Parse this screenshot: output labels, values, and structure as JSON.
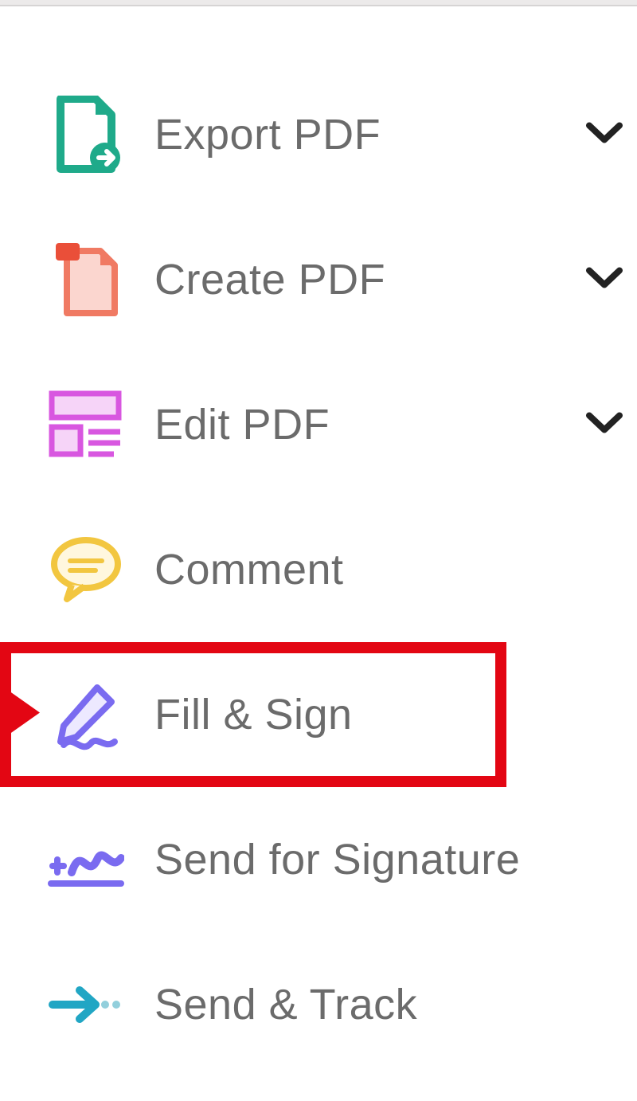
{
  "tools": {
    "items": [
      {
        "label": "Export PDF",
        "expandable": true
      },
      {
        "label": "Create PDF",
        "expandable": true
      },
      {
        "label": "Edit PDF",
        "expandable": true
      },
      {
        "label": "Comment",
        "expandable": false
      },
      {
        "label": "Fill & Sign",
        "expandable": false,
        "highlighted": true
      },
      {
        "label": "Send for Signature",
        "expandable": false
      },
      {
        "label": "Send & Track",
        "expandable": false
      }
    ]
  }
}
